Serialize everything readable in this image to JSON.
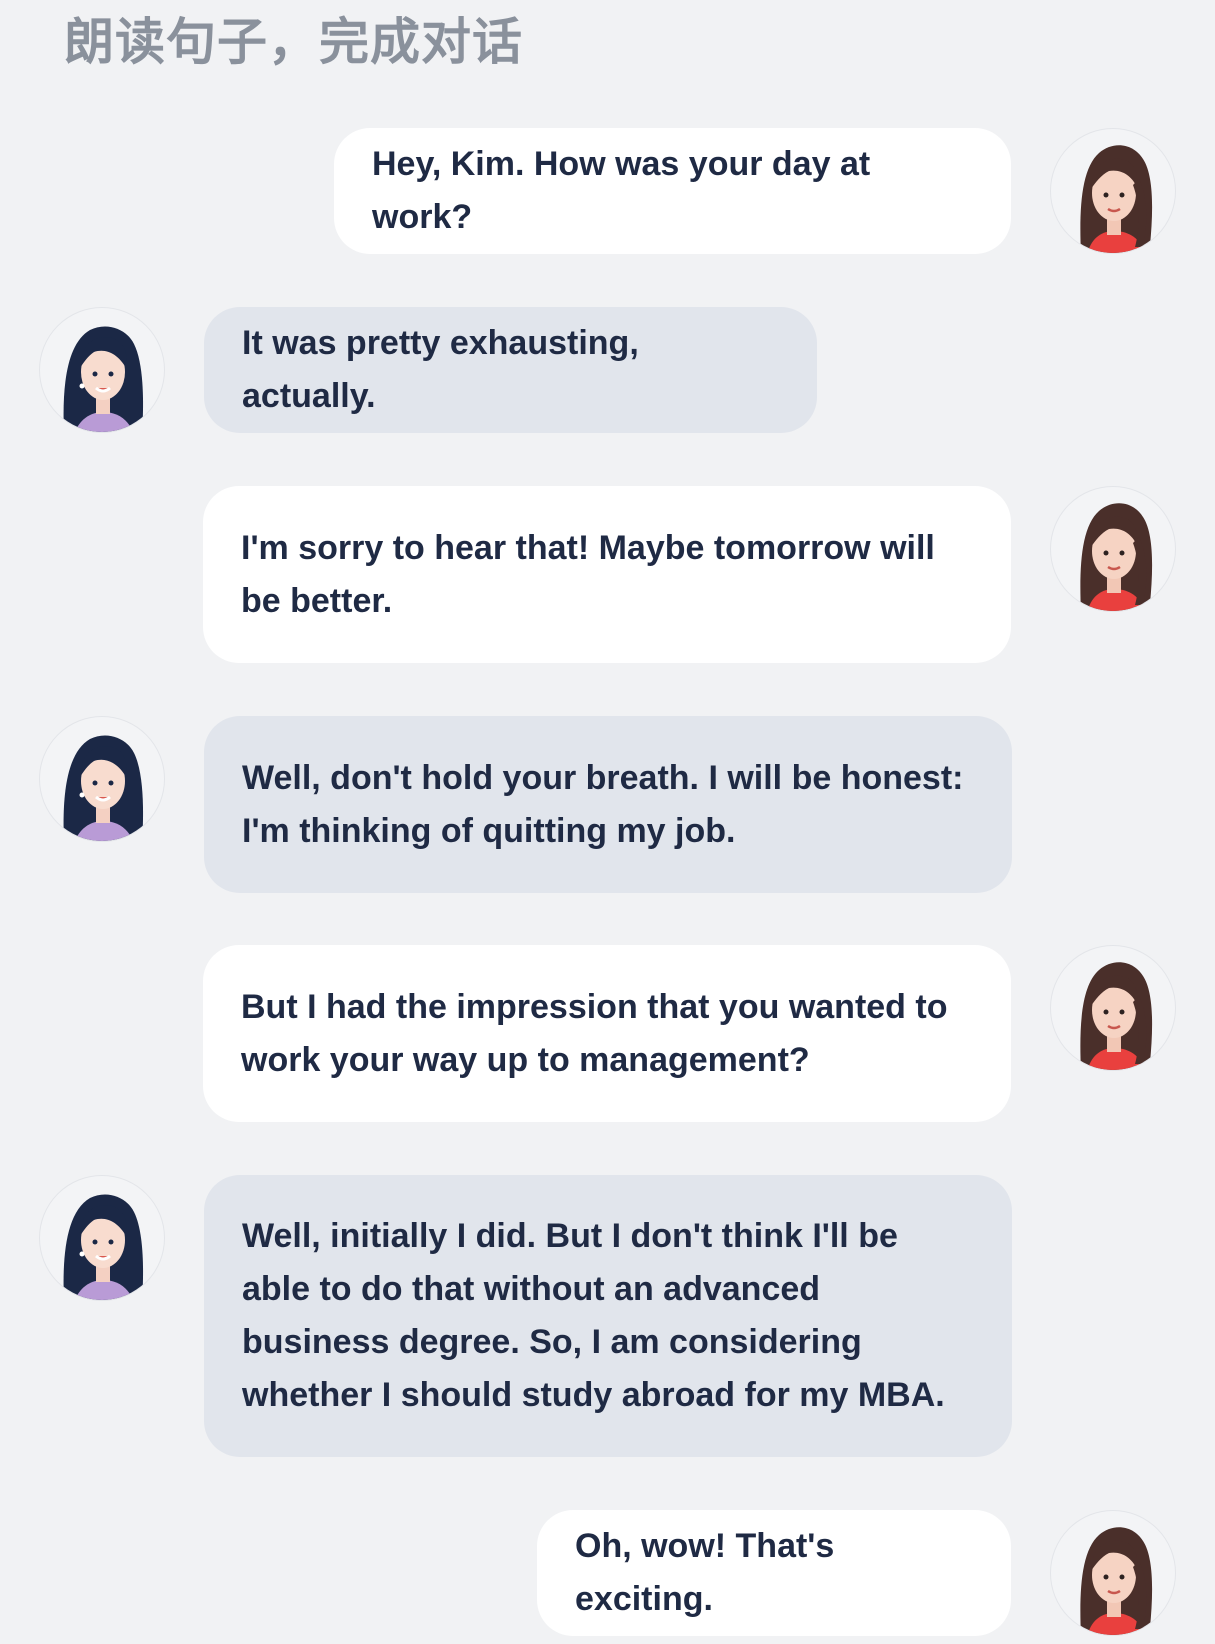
{
  "header": {
    "title": "朗读句子，完成对话"
  },
  "messages": [
    {
      "speaker": "self",
      "text": "Hey, Kim. How was your day at work?"
    },
    {
      "speaker": "other",
      "text": "It was pretty exhausting, actually."
    },
    {
      "speaker": "self",
      "text": "I'm sorry to hear that! Maybe tomorrow will be better."
    },
    {
      "speaker": "other",
      "text": "Well, don't hold your breath. I will be honest: I'm thinking of quitting my job."
    },
    {
      "speaker": "self",
      "text": "But I had the impression that you wanted to work your way up to management?"
    },
    {
      "speaker": "other",
      "text": "Well, initially I did. But I don't think I'll be able to do that without an advanced business degree. So, I am considering whether I should study abroad for my MBA."
    },
    {
      "speaker": "self",
      "text": "Oh, wow! That's exciting."
    }
  ],
  "colors": {
    "page_background": "#f1f2f4",
    "self_bubble": "#ffffff",
    "other_bubble": "#e1e5ec",
    "text": "#1f2a44",
    "title": "#8a919c"
  }
}
